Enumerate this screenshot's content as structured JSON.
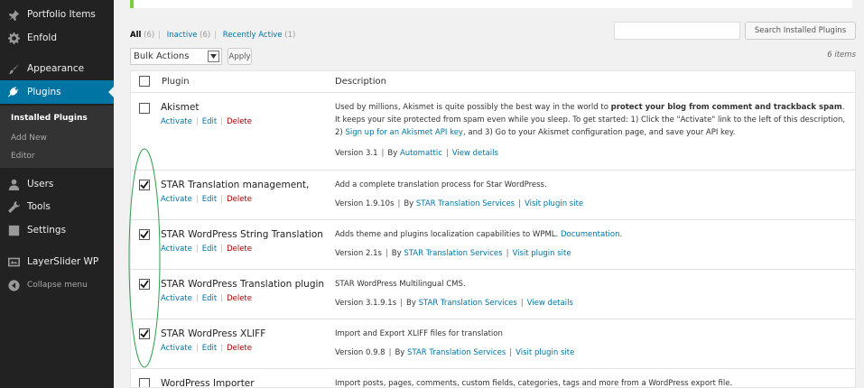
{
  "sidebar": {
    "items": [
      {
        "label": "Portfolio Items",
        "icon": "pin-icon"
      },
      {
        "label": "Enfold",
        "icon": "gear-icon"
      },
      {
        "label": "Appearance",
        "icon": "brush-icon"
      },
      {
        "label": "Plugins",
        "icon": "plug-icon"
      },
      {
        "label": "Users",
        "icon": "user-icon"
      },
      {
        "label": "Tools",
        "icon": "wrench-icon"
      },
      {
        "label": "Settings",
        "icon": "settings-icon"
      },
      {
        "label": "LayerSlider WP",
        "icon": "slider-icon"
      },
      {
        "label": "Collapse menu",
        "icon": "collapse-icon"
      }
    ],
    "submenu": [
      "Installed Plugins",
      "Add New",
      "Editor"
    ]
  },
  "filters": {
    "all": "All",
    "all_count": "(6)",
    "inactive": "Inactive",
    "inactive_count": "(6)",
    "recent": "Recently Active",
    "recent_count": "(1)",
    "sep": "|"
  },
  "search": {
    "value": "",
    "button": "Search Installed Plugins"
  },
  "bulk": {
    "selected": "Bulk Actions",
    "apply": "Apply"
  },
  "items_count": "6 items",
  "table": {
    "col_plugin": "Plugin",
    "col_description": "Description",
    "actions": {
      "activate": "Activate",
      "edit": "Edit",
      "delete": "Delete",
      "pipe": "|"
    },
    "meta_sep": "|",
    "rows": [
      {
        "name": "Akismet",
        "checked": false,
        "desc_pre": "Used by millions, Akismet is quite possibly the best way in the world to ",
        "desc_bold": "protect your blog from comment and trackback spam",
        "desc_mid": ". It keeps your site protected from spam even while you sleep. To get started: 1) Click the \"Activate\" link to the left of this description, 2) ",
        "desc_link": "Sign up for an Akismet API key",
        "desc_post": ", and 3) Go to your Akismet configuration page, and save your API key.",
        "version": "Version 3.1",
        "by": "By",
        "author": "Automattic",
        "extra_link": "View details"
      },
      {
        "name": "STAR Translation management,",
        "checked": true,
        "desc": "Add a complete translation process for Star WordPress.",
        "version": "Version 1.9.10s",
        "by": "By",
        "author": "STAR Translation Services",
        "extra_link": "Visit plugin site"
      },
      {
        "name": "STAR WordPress String Translation",
        "checked": true,
        "desc": "Adds theme and plugins localization capabilities to WPML.",
        "desc_link": "Documentation",
        "desc_post": ".",
        "version": "Version 2.1s",
        "by": "By",
        "author": "STAR Translation Services",
        "extra_link": "Visit plugin site"
      },
      {
        "name": "STAR WordPress Translation plugin",
        "checked": true,
        "desc": "STAR WordPress Multilingual CMS.",
        "version": "Version 3.1.9.1s",
        "by": "By",
        "author": "STAR Translation Services",
        "extra_link": "View details"
      },
      {
        "name": "STAR WordPress XLIFF",
        "checked": true,
        "desc": "Import and Export XLIFF files for translation",
        "version": "Version 0.9.8",
        "by": "By",
        "author": "STAR Translation Services",
        "extra_link": "Visit plugin site"
      },
      {
        "name": "WordPress Importer",
        "checked": false,
        "desc": "Import posts, pages, comments, custom fields, categories, tags and more from a WordPress export file."
      }
    ]
  },
  "colors": {
    "sidebar_bg": "#222222",
    "active_menu": "#0074a2",
    "link": "#0074a2",
    "delete": "#aa0000",
    "annotation_oval": "#2e9e4f",
    "notice_border": "#7ad03a"
  }
}
